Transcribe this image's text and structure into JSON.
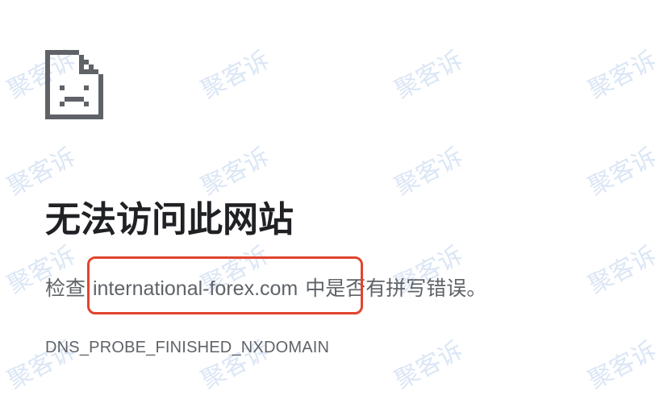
{
  "error_page": {
    "icon": "sad-document-icon",
    "title": "无法访问此网站",
    "message_prefix": "检查 ",
    "domain": "international-forex.com",
    "message_suffix": " 中是否有拼写错误。",
    "error_code": "DNS_PROBE_FINISHED_NXDOMAIN"
  },
  "annotation": {
    "highlight_color": "#e0452e"
  },
  "watermark": {
    "text": "聚客诉",
    "color": "#73a0d7"
  }
}
